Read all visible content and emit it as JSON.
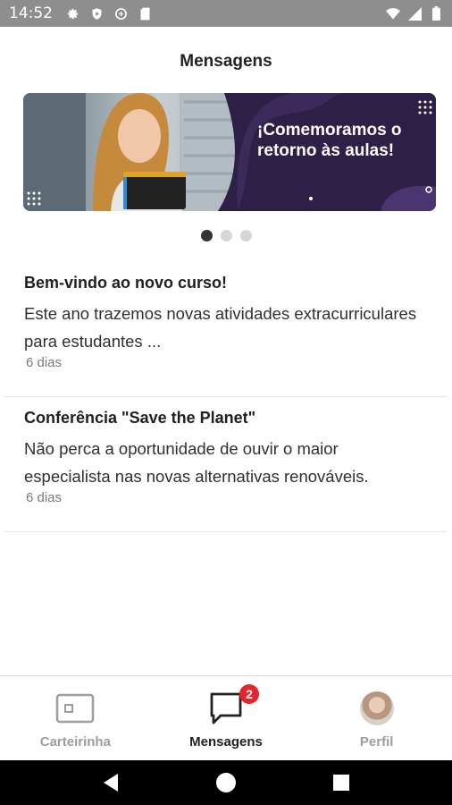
{
  "status_bar": {
    "time": "14:52",
    "icons_left": [
      "gear-icon",
      "shield-play-icon",
      "vpn-icon",
      "sd-card-icon"
    ],
    "icons_right": [
      "wifi-icon",
      "cellular-icon",
      "battery-icon"
    ]
  },
  "header": {
    "title": "Mensagens"
  },
  "banner": {
    "text": "¡Comemoramos o retorno às aulas!",
    "pager": {
      "count": 3,
      "active_index": 0
    }
  },
  "messages": [
    {
      "title": "Bem-vindo ao novo curso!",
      "preview": "Este ano trazemos novas atividades extracurriculares para estudantes ...",
      "time": "6 dias"
    },
    {
      "title": "Conferência \"Save the Planet\"",
      "preview": "Não perca a oportunidade de ouvir o maior especialista nas novas alternativas renováveis.",
      "time": "6 dias"
    }
  ],
  "bottom_nav": {
    "items": [
      {
        "label": "Carteirinha",
        "icon": "id-card-icon",
        "active": false
      },
      {
        "label": "Mensagens",
        "icon": "chat-icon",
        "active": true,
        "badge": "2"
      },
      {
        "label": "Perfil",
        "icon": "avatar",
        "active": false
      }
    ]
  },
  "system_nav": [
    "back-icon",
    "home-icon",
    "recents-icon"
  ],
  "colors": {
    "status_bar": "#8e8e8e",
    "banner_bg": "#2d1f45",
    "badge": "#e5242c",
    "active_text": "#222222",
    "inactive_text": "#9d9d9d"
  }
}
